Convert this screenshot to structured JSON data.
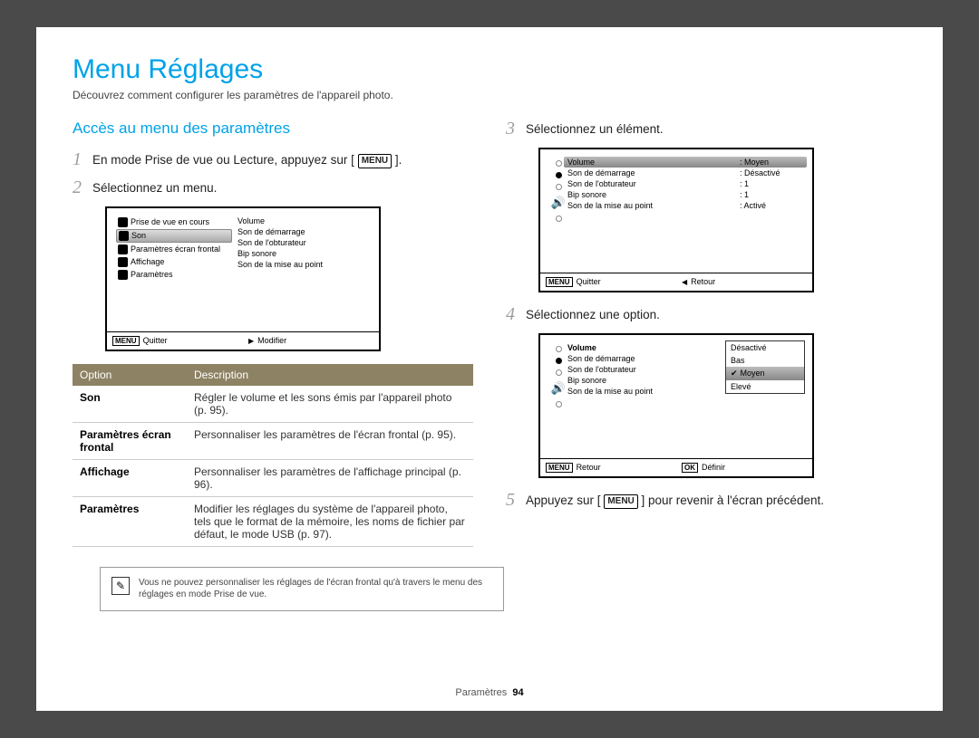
{
  "page": {
    "title": "Menu Réglages",
    "subtitle": "Découvrez comment configurer les paramètres de l'appareil photo.",
    "footer_label": "Paramètres",
    "footer_page": "94"
  },
  "left": {
    "section_heading": "Accès au menu des paramètres",
    "step1_pre": "En mode Prise de vue ou Lecture, appuyez sur [",
    "step1_btn": "MENU",
    "step1_post": "].",
    "step2": "Sélectionnez un menu.",
    "shot1": {
      "left_items": [
        "Prise de vue en cours",
        "Son",
        "Paramètres écran frontal",
        "Affichage",
        "Paramètres"
      ],
      "right_items": [
        "Volume",
        "Son de démarrage",
        "Son de l'obturateur",
        "Bip sonore",
        "Son de la mise au point"
      ],
      "foot_left_tag": "MENU",
      "foot_left": "Quitter",
      "foot_right_icon": "▶",
      "foot_right": "Modifier"
    },
    "table": {
      "head_option": "Option",
      "head_desc": "Description",
      "rows": [
        {
          "o": "Son",
          "d": "Régler le volume et les sons émis par l'appareil photo (p. 95)."
        },
        {
          "o": "Paramètres écran frontal",
          "d": "Personnaliser les paramètres de l'écran frontal (p. 95)."
        },
        {
          "o": "Affichage",
          "d": "Personnaliser les paramètres de l'affichage principal (p. 96)."
        },
        {
          "o": "Paramètres",
          "d": "Modifier les réglages du système de l'appareil photo, tels que le format de la mémoire, les noms de fichier par défaut, le mode USB (p. 97)."
        }
      ]
    },
    "note": "Vous ne pouvez personnaliser les réglages de l'écran frontal qu'à travers le menu des réglages en mode Prise de vue."
  },
  "right": {
    "step3": "Sélectionnez un élément.",
    "shot3": {
      "rows": [
        {
          "k": "Volume",
          "v": ": Moyen",
          "sel": true
        },
        {
          "k": "Son de démarrage",
          "v": ": Désactivé"
        },
        {
          "k": "Son de l'obturateur",
          "v": ": 1"
        },
        {
          "k": "Bip sonore",
          "v": ": 1"
        },
        {
          "k": "Son de la mise au point",
          "v": ": Activé"
        }
      ],
      "foot_left_tag": "MENU",
      "foot_left": "Quitter",
      "foot_right_icon": "◀",
      "foot_right": "Retour"
    },
    "step4": "Sélectionnez une option.",
    "shot4": {
      "rows": [
        {
          "k": "Volume",
          "bold": true
        },
        {
          "k": "Son de démarrage"
        },
        {
          "k": "Son de l'obturateur"
        },
        {
          "k": "Bip sonore"
        },
        {
          "k": "Son de la mise au point"
        }
      ],
      "popup": [
        {
          "label": "Désactivé"
        },
        {
          "label": "Bas"
        },
        {
          "label": "Moyen",
          "sel": true
        },
        {
          "label": "Elevé"
        }
      ],
      "foot_left_tag": "MENU",
      "foot_left": "Retour",
      "foot_right_tag": "OK",
      "foot_right": "Définir"
    },
    "step5_pre": "Appuyez sur [",
    "step5_btn": "MENU",
    "step5_post": "] pour revenir à l'écran précédent."
  }
}
